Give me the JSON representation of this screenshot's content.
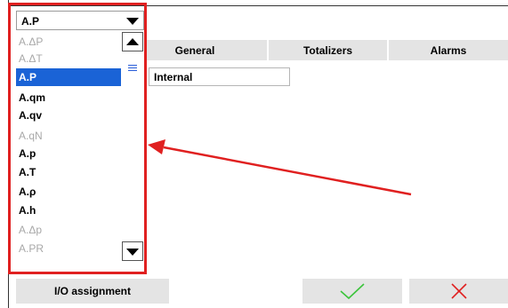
{
  "dropdown": {
    "selected_value": "A.P",
    "items": [
      {
        "label": "A.ΔP",
        "enabled": false
      },
      {
        "label": "A.ΔT",
        "enabled": false
      },
      {
        "label": "A.P",
        "enabled": true,
        "selected": true
      },
      {
        "label": "A.qm",
        "enabled": true
      },
      {
        "label": "A.qv",
        "enabled": true
      },
      {
        "label": "A.qN",
        "enabled": false
      },
      {
        "label": "A.p",
        "enabled": true
      },
      {
        "label": "A.T",
        "enabled": true
      },
      {
        "label": "A.ρ",
        "enabled": true
      },
      {
        "label": "A.h",
        "enabled": true
      },
      {
        "label": "A.Δp",
        "enabled": false
      },
      {
        "label": "A.PR",
        "enabled": false
      }
    ]
  },
  "tabs": [
    {
      "label": "General"
    },
    {
      "label": "Totalizers"
    },
    {
      "label": "Alarms"
    }
  ],
  "field": {
    "value": "Internal"
  },
  "buttons": {
    "io_assignment": "I/O assignment",
    "confirm_icon": "check-icon",
    "cancel_icon": "close-icon"
  },
  "colors": {
    "selection": "#1a63d6",
    "annotation": "#e02020",
    "confirm": "#3cc43c",
    "cancel": "#e02020",
    "button_bg": "#e4e4e4"
  }
}
